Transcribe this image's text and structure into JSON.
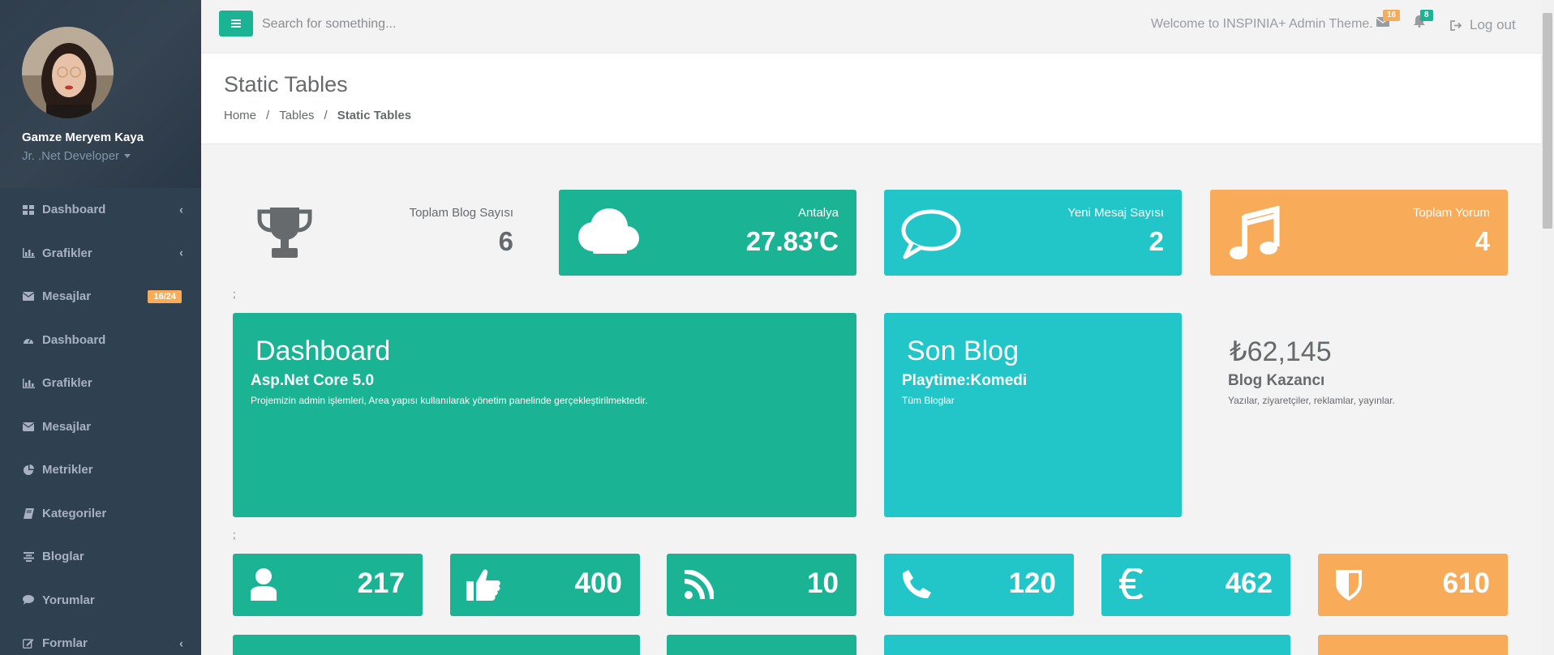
{
  "user": {
    "name": "Gamze Meryem Kaya",
    "role": "Jr. .Net Developer"
  },
  "sidebar": {
    "items": [
      {
        "label": "Dashboard",
        "icon": "th-large-icon",
        "chevron": true
      },
      {
        "label": "Grafikler",
        "icon": "bar-chart-icon",
        "chevron": true
      },
      {
        "label": "Mesajlar",
        "icon": "envelope-icon",
        "badge": "16/24"
      },
      {
        "label": "Dashboard",
        "icon": "dashboard-icon"
      },
      {
        "label": "Grafikler",
        "icon": "bar-chart-icon"
      },
      {
        "label": "Mesajlar",
        "icon": "envelope-icon"
      },
      {
        "label": "Metrikler",
        "icon": "pie-chart-icon"
      },
      {
        "label": "Kategoriler",
        "icon": "book-icon"
      },
      {
        "label": "Bloglar",
        "icon": "align-center-icon"
      },
      {
        "label": "Yorumlar",
        "icon": "comment-icon"
      },
      {
        "label": "Formlar",
        "icon": "edit-icon",
        "chevron": true
      }
    ]
  },
  "topbar": {
    "search_placeholder": "Search for something...",
    "welcome": "Welcome to INSPINIA+ Admin Theme.",
    "mail_badge": "16",
    "bell_badge": "8",
    "logout": "Log out"
  },
  "heading": {
    "title": "Static Tables",
    "breadcrumb": [
      "Home",
      "Tables",
      "Static Tables"
    ]
  },
  "stats": {
    "blog": {
      "label": "Toplam Blog Sayısı",
      "value": "6"
    },
    "weather": {
      "label": "Antalya",
      "value": "27.83'C"
    },
    "messages": {
      "label": "Yeni Mesaj Sayısı",
      "value": "2"
    },
    "comments": {
      "label": "Toplam Yorum",
      "value": "4"
    }
  },
  "semicolon": ";",
  "panels": {
    "dashboard": {
      "title": "Dashboard",
      "subtitle": "Asp.Net Core 5.0",
      "desc": "Projemizin admin işlemleri, Area yapısı kullanılarak yönetim panelinde gerçekleştirilmektedir."
    },
    "sonblog": {
      "title": "Son Blog",
      "subtitle": "Playtime:Komedi",
      "desc": "Tüm Bloglar"
    },
    "earnings": {
      "title": "₺62,145",
      "subtitle": "Blog Kazancı",
      "desc": "Yazılar, ziyaretçiler, reklamlar, yayınlar."
    }
  },
  "small_stats": [
    {
      "icon": "user-icon",
      "value": "217",
      "color": "#1ab394"
    },
    {
      "icon": "thumbs-up-icon",
      "value": "400",
      "color": "#1ab394"
    },
    {
      "icon": "rss-icon",
      "value": "10",
      "color": "#1ab394"
    },
    {
      "icon": "phone-icon",
      "value": "120",
      "color": "#23c6c8"
    },
    {
      "icon": "euro-icon",
      "value": "462",
      "color": "#23c6c8"
    },
    {
      "icon": "shield-icon",
      "value": "610",
      "color": "#f8ac59"
    }
  ],
  "colors": {
    "sidebar": "#2f4050",
    "green": "#1ab394",
    "teal": "#23c6c8",
    "orange": "#f8ac59"
  }
}
